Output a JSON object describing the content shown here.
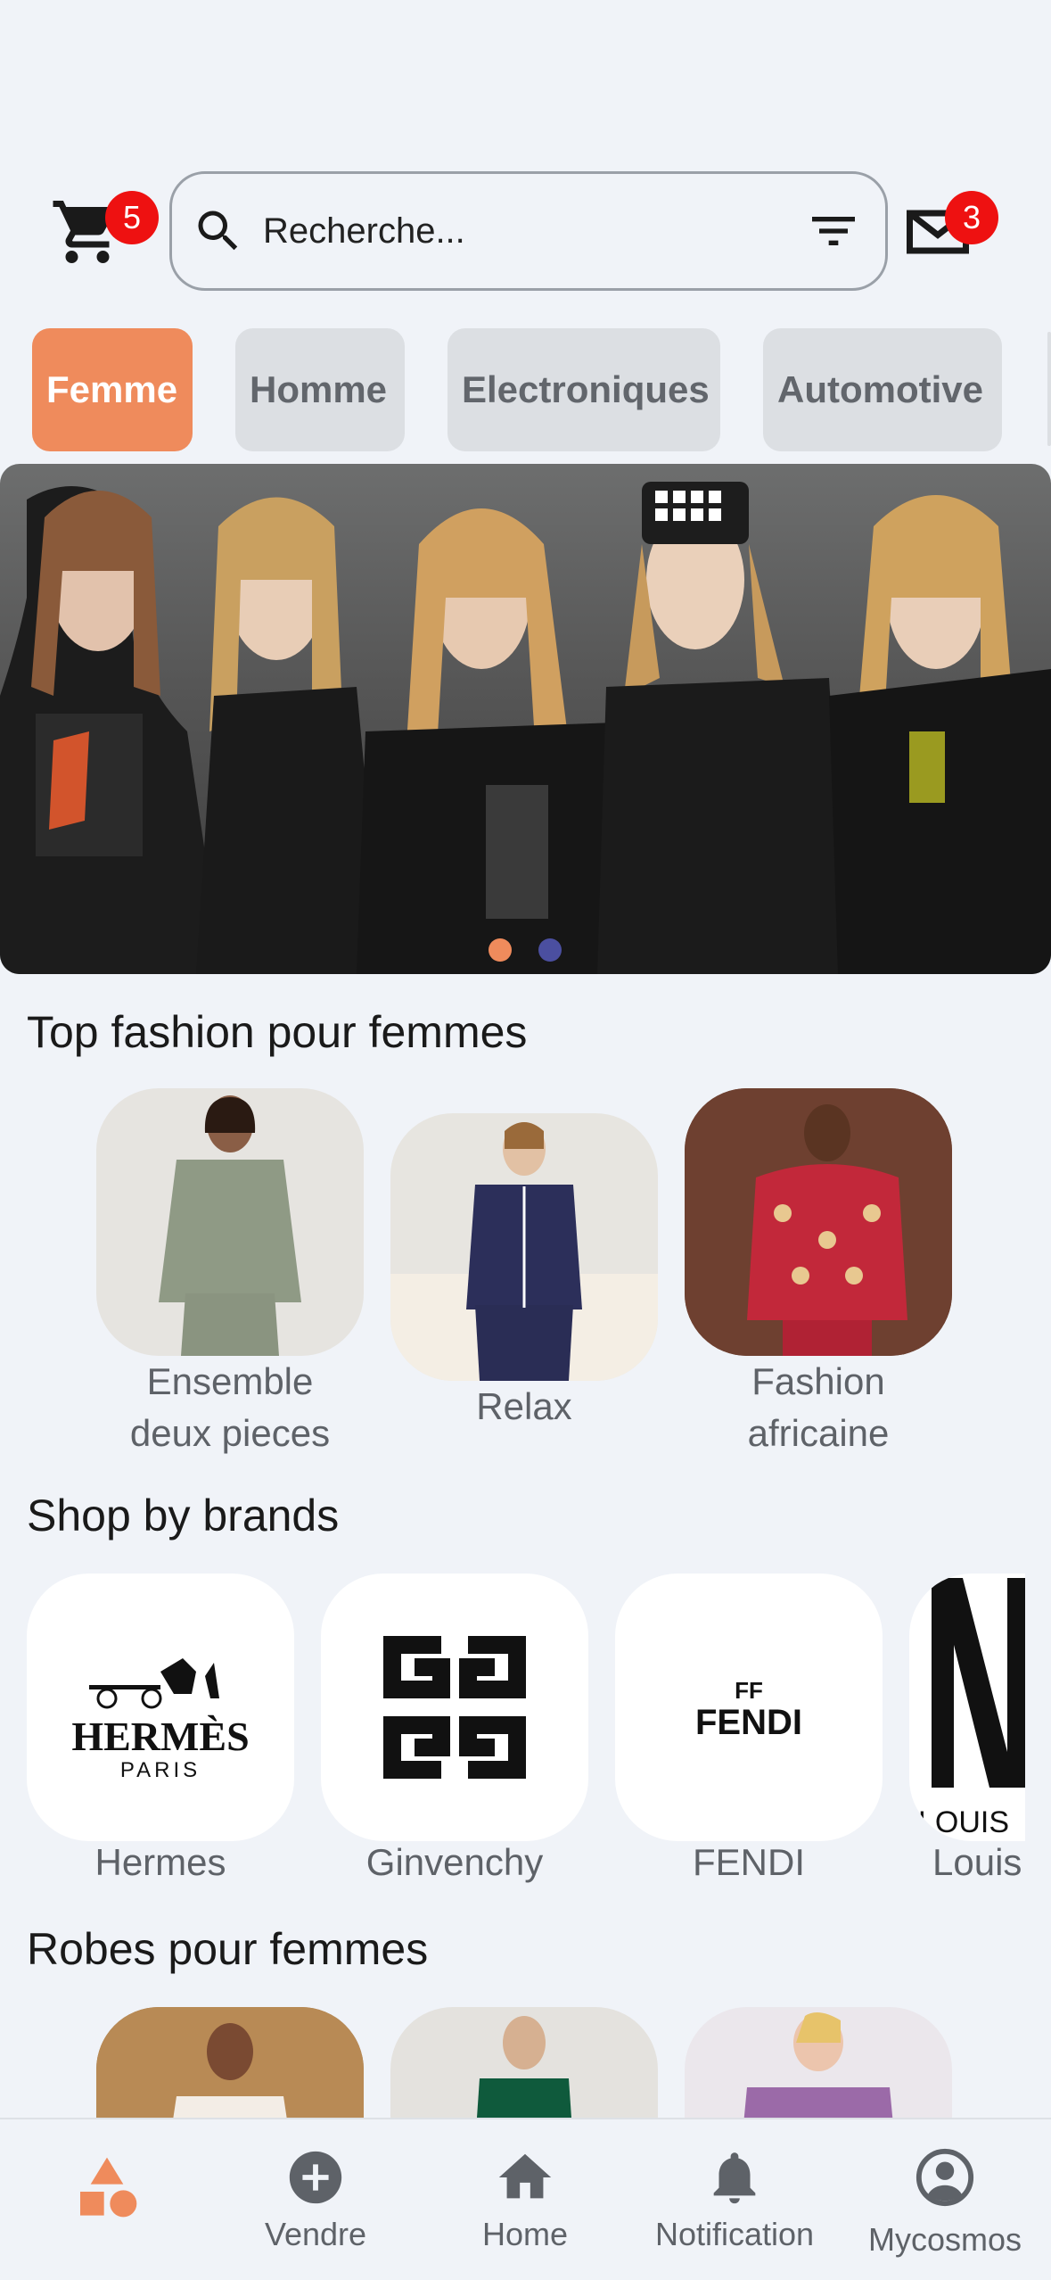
{
  "header": {
    "cart_count": "5",
    "search_placeholder": "Recherche...",
    "mail_count": "3"
  },
  "categories": [
    "Femme",
    "Homme",
    "Electroniques",
    "Automotive"
  ],
  "sections": {
    "top_fashion": {
      "title": "Top fashion pour femmes",
      "items": [
        {
          "label_line1": "Ensemble",
          "label_line2": "deux pieces"
        },
        {
          "label_line1": "Relax",
          "label_line2": ""
        },
        {
          "label_line1": "Fashion",
          "label_line2": "africaine"
        }
      ]
    },
    "brands": {
      "title": "Shop by brands",
      "items": [
        {
          "label": "Hermes",
          "logo_main": "HERMÈS",
          "logo_sub": "PARIS"
        },
        {
          "label": "Ginvenchy"
        },
        {
          "label": "FENDI",
          "logo_main": "FENDI",
          "logo_mark": "FF"
        },
        {
          "label": "Louis",
          "logo_text": "LOUIS"
        }
      ]
    },
    "dresses": {
      "title": "Robes pour femmes"
    }
  },
  "bottom_nav": [
    {
      "label": "",
      "icon": "shapes-icon"
    },
    {
      "label": "Vendre",
      "icon": "plus-circle-icon"
    },
    {
      "label": "Home",
      "icon": "home-icon"
    },
    {
      "label": "Notification",
      "icon": "bell-icon"
    },
    {
      "label": "Mycosmos",
      "icon": "account-circle-icon"
    }
  ],
  "colors": {
    "accent": "#ef8b5c",
    "badge": "#ee1111",
    "background": "#f0f3f8"
  }
}
